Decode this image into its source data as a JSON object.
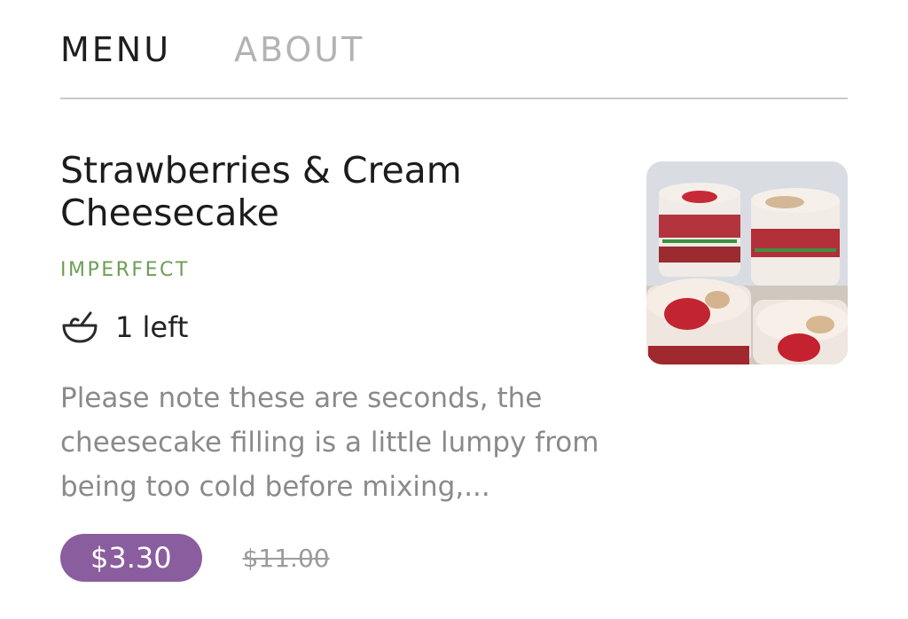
{
  "tabs": {
    "menu": "MENU",
    "about": "ABOUT"
  },
  "item": {
    "title": "Strawberries & Cream Cheesecake",
    "tag": "IMPERFECT",
    "stock_icon": "bowl-icon",
    "stock_text": "1 left",
    "description": "Please note these are seconds, the cheesecake filling is a little lumpy from being too cold before mixing,...",
    "price": "$3.30",
    "original_price": "$11.00"
  },
  "colors": {
    "tab_active": "#1e1e1e",
    "tab_inactive": "#b3b3b3",
    "tag": "#6e9e56",
    "price_pill": "#8a5e9e"
  }
}
